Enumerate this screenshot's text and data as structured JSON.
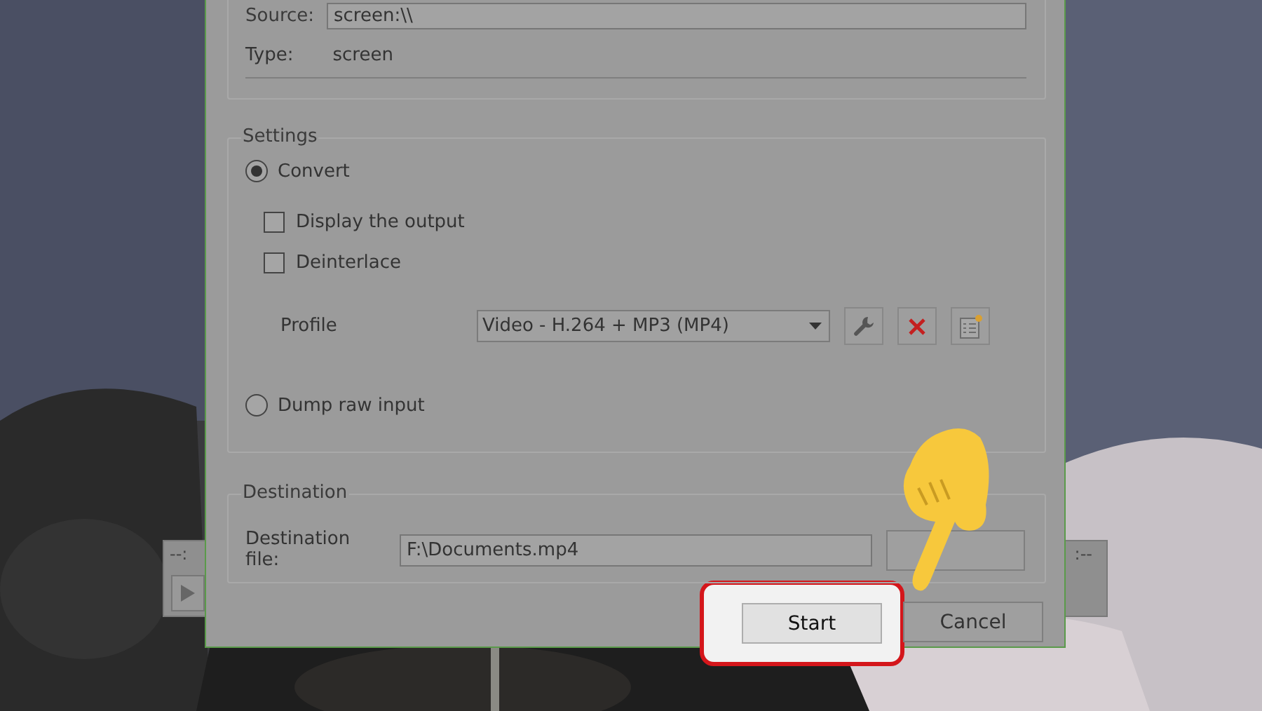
{
  "source": {
    "label": "Source:",
    "value": "screen:\\\\"
  },
  "type": {
    "label": "Type:",
    "value": "screen"
  },
  "settings": {
    "title": "Settings",
    "options": [
      {
        "label": "Convert",
        "selected": true
      },
      {
        "label": "Dump raw input",
        "selected": false
      }
    ],
    "checkboxes": [
      {
        "label": "Display the output",
        "checked": false
      },
      {
        "label": "Deinterlace",
        "checked": false
      }
    ],
    "profile": {
      "label": "Profile",
      "value": "Video - H.264 + MP3 (MP4)"
    }
  },
  "destination": {
    "title": "Destination",
    "label": "Destination file:",
    "value": "F:\\Documents.mp4"
  },
  "buttons": [
    {
      "label": "Start",
      "highlighted": true
    },
    {
      "label": "Cancel",
      "highlighted": false
    }
  ],
  "player": {
    "time_left": "--:",
    "time_right": ":--"
  }
}
